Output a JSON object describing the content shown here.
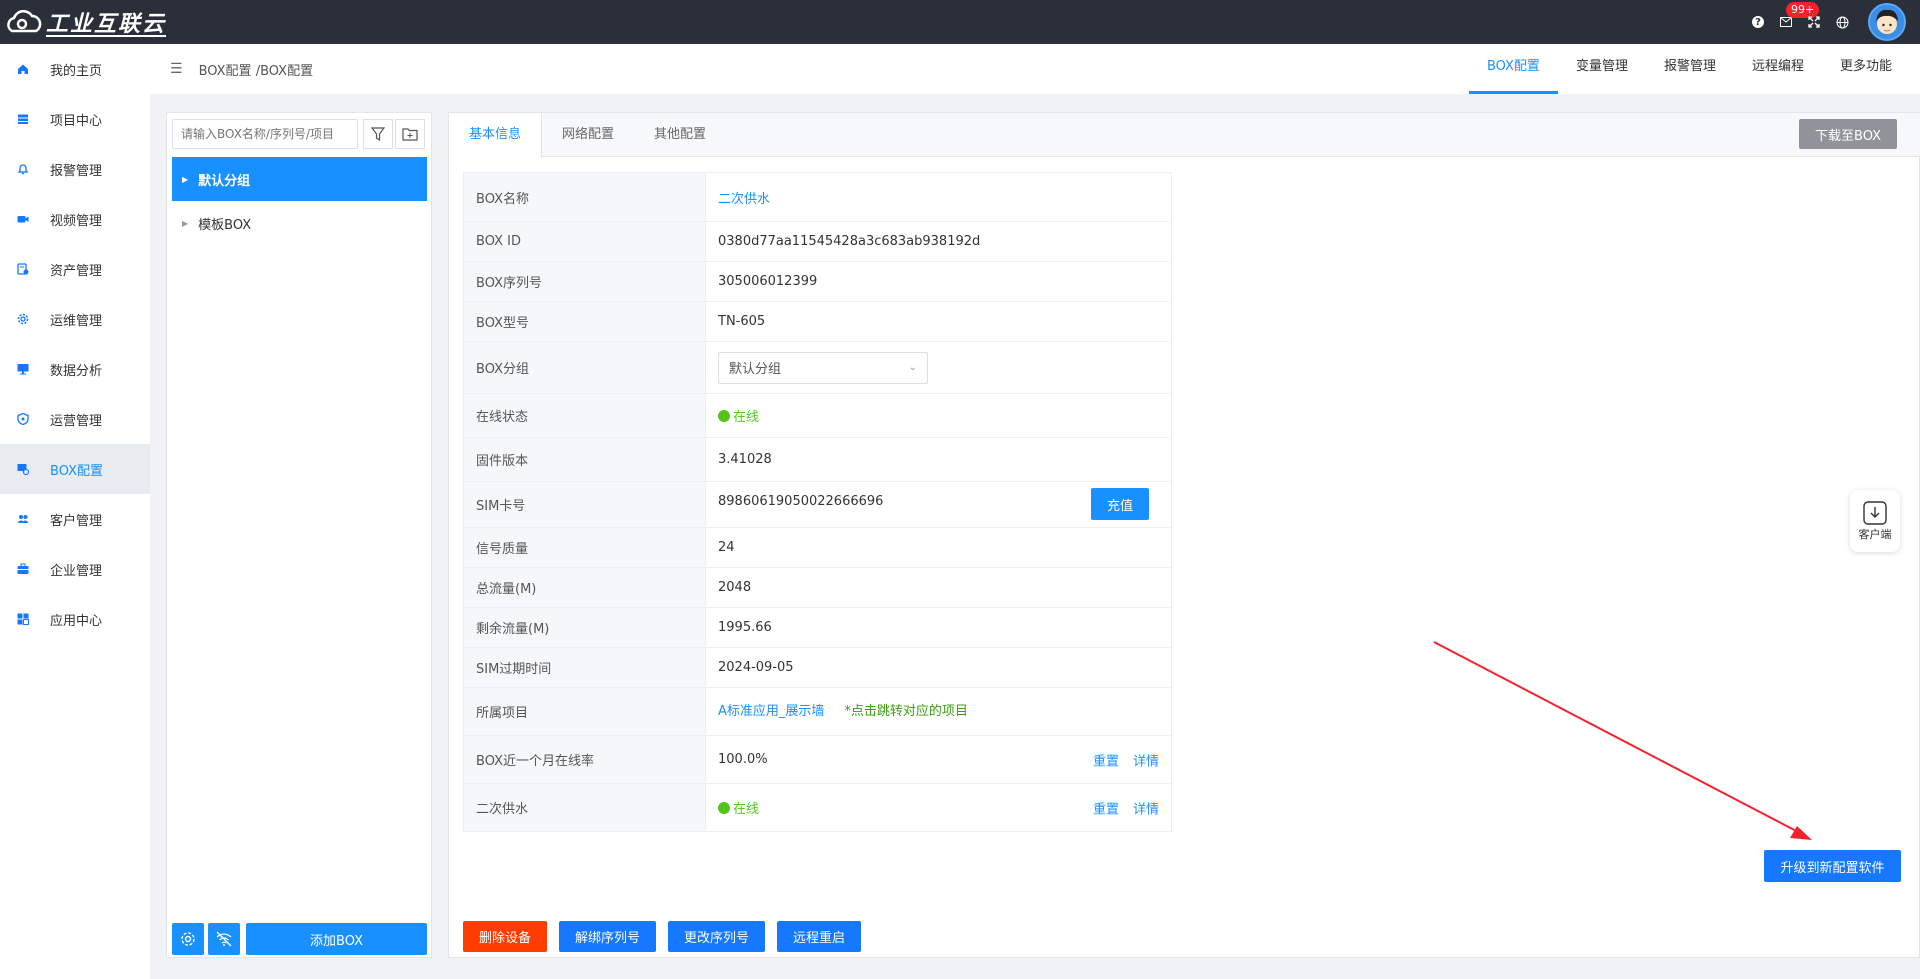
{
  "app": {
    "logo_text": "工业互联云"
  },
  "topbar": {
    "badge": "99+"
  },
  "sidebar": {
    "items": [
      {
        "label": "我的主页",
        "icon": "home-icon"
      },
      {
        "label": "项目中心",
        "icon": "database-icon"
      },
      {
        "label": "报警管理",
        "icon": "bell-icon"
      },
      {
        "label": "视频管理",
        "icon": "video-icon"
      },
      {
        "label": "资产管理",
        "icon": "asset-icon"
      },
      {
        "label": "运维管理",
        "icon": "gear-icon"
      },
      {
        "label": "数据分析",
        "icon": "monitor-icon"
      },
      {
        "label": "运营管理",
        "icon": "shield-icon"
      },
      {
        "label": "BOX配置",
        "icon": "box-config-icon"
      },
      {
        "label": "客户管理",
        "icon": "users-icon"
      },
      {
        "label": "企业管理",
        "icon": "briefcase-icon"
      },
      {
        "label": "应用中心",
        "icon": "apps-icon"
      }
    ],
    "active_index": 8
  },
  "header": {
    "breadcrumb": "BOX配置 /BOX配置",
    "tabs": [
      "BOX配置",
      "变量管理",
      "报警管理",
      "远程编程",
      "更多功能"
    ]
  },
  "tree": {
    "search_placeholder": "请输入BOX名称/序列号/项目",
    "nodes": [
      "默认分组",
      "模板BOX"
    ],
    "add_label": "添加BOX"
  },
  "main": {
    "tabs": [
      "基本信息",
      "网络配置",
      "其他配置"
    ],
    "download_label": "下载至BOX",
    "rows": {
      "box_name": {
        "label": "BOX名称",
        "value": "二次供水"
      },
      "box_id": {
        "label": "BOX ID",
        "value": "0380d77aa11545428a3c683ab938192d"
      },
      "serial": {
        "label": "BOX序列号",
        "value": "305006012399"
      },
      "model": {
        "label": "BOX型号",
        "value": "TN-605"
      },
      "group": {
        "label": "BOX分组",
        "value": "默认分组"
      },
      "status": {
        "label": "在线状态",
        "value": "在线"
      },
      "firmware": {
        "label": "固件版本",
        "value": "3.41028"
      },
      "sim": {
        "label": "SIM卡号",
        "value": "89860619050022666696",
        "action": "充值"
      },
      "signal": {
        "label": "信号质量",
        "value": "24"
      },
      "total_flow": {
        "label": "总流量(M)",
        "value": "2048"
      },
      "remaining_flow": {
        "label": "剩余流量(M)",
        "value": "1995.66"
      },
      "sim_expiry": {
        "label": "SIM过期时间",
        "value": "2024-09-05"
      },
      "project": {
        "label": "所属项目",
        "value": "A标准应用_展示墙",
        "hint": "*点击跳转对应的项目"
      },
      "online_rate": {
        "label": "BOX近一个月在线率",
        "value": "100.0%",
        "reset": "重置",
        "detail": "详情"
      },
      "water": {
        "label": "二次供水",
        "value": "在线",
        "reset": "重置",
        "detail": "详情"
      }
    },
    "actions": {
      "delete": "删除设备",
      "unbind": "解绑序列号",
      "change_serial": "更改序列号",
      "reboot": "远程重启"
    },
    "upgrade_label": "升级到新配置软件",
    "client_label": "客户端"
  },
  "colors": {
    "primary": "#1890ff",
    "danger": "#ff3d00",
    "online": "#52c41a",
    "topbar": "#2b2f3a",
    "annotation_arrow": "#f5222d"
  }
}
